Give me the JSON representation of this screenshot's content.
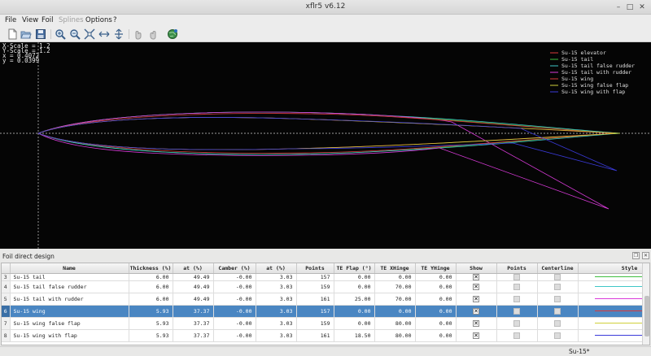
{
  "window": {
    "title": "xflr5 v6.12",
    "min_glyph": "–",
    "max_glyph": "□",
    "close_glyph": "✕"
  },
  "menu": {
    "items": [
      {
        "label": "File",
        "enabled": true
      },
      {
        "label": "View",
        "enabled": true
      },
      {
        "label": "Foil",
        "enabled": true
      },
      {
        "label": "Splines",
        "enabled": false
      },
      {
        "label": "Options",
        "enabled": true
      },
      {
        "label": "?",
        "enabled": true
      }
    ]
  },
  "toolbar": {
    "icons": [
      "new-file-icon",
      "open-file-icon",
      "save-icon",
      "zoom-in-icon",
      "zoom-out-icon",
      "reset-view-icon",
      "reset-x-scale-icon",
      "reset-y-scale-icon",
      "undo-icon",
      "redo-icon",
      "export-globe-icon"
    ]
  },
  "readout": {
    "x_scale": "X-Scale =  1.2",
    "y_scale": "Y-Scale =  1.2",
    "x": "x =  0.4072",
    "y": "y =  0.0399"
  },
  "legend": [
    {
      "name": "Su-15 elevator",
      "color": "#d93a3a"
    },
    {
      "name": "Su-15 tail",
      "color": "#3fbf3f"
    },
    {
      "name": "Su-15 tail false rudder",
      "color": "#3fc7c7"
    },
    {
      "name": "Su-15 tail with rudder",
      "color": "#d93ad9"
    },
    {
      "name": "Su-15 wing",
      "color": "#d93a3a"
    },
    {
      "name": "Su-15 wing false flap",
      "color": "#cfcf3a"
    },
    {
      "name": "Su-15 wing with flap",
      "color": "#3a3ad9"
    }
  ],
  "dock": {
    "title": "Foil direct design"
  },
  "table": {
    "headers": [
      "",
      "Name",
      "Thickness (%)",
      "at (%)",
      "Camber (%)",
      "at (%)",
      "Points",
      "TE Flap (°)",
      "TE XHinge",
      "TE YHinge",
      "Show",
      "Points",
      "Centerline",
      "Style"
    ],
    "rows": [
      {
        "index": "3",
        "name": "Su-15 tail",
        "thickness": "6.00",
        "thickness_at": "49.49",
        "camber": "-0.00",
        "camber_at": "3.03",
        "points": "157",
        "te_flap": "0.00",
        "te_xhinge": "0.00",
        "te_yhinge": "0.00",
        "show": "✕",
        "style_color": "#3fbf3f",
        "partial": true,
        "selected": false
      },
      {
        "index": "4",
        "name": "Su-15 tail false rudder",
        "thickness": "6.00",
        "thickness_at": "49.49",
        "camber": "-0.00",
        "camber_at": "3.03",
        "points": "159",
        "te_flap": "0.00",
        "te_xhinge": "70.00",
        "te_yhinge": "0.00",
        "show": "✕",
        "style_color": "#3fc7c7",
        "partial": false,
        "selected": false
      },
      {
        "index": "5",
        "name": "Su-15 tail with rudder",
        "thickness": "6.00",
        "thickness_at": "49.49",
        "camber": "-0.00",
        "camber_at": "3.03",
        "points": "161",
        "te_flap": "25.00",
        "te_xhinge": "70.00",
        "te_yhinge": "0.00",
        "show": "✕",
        "style_color": "#d93ad9",
        "partial": false,
        "selected": false
      },
      {
        "index": "6",
        "name": "Su-15 wing",
        "thickness": "5.93",
        "thickness_at": "37.37",
        "camber": "-0.00",
        "camber_at": "3.03",
        "points": "157",
        "te_flap": "0.00",
        "te_xhinge": "0.00",
        "te_yhinge": "0.00",
        "show": "✕",
        "style_color": "#d93a3a",
        "partial": false,
        "selected": true
      },
      {
        "index": "7",
        "name": "Su-15 wing false flap",
        "thickness": "5.93",
        "thickness_at": "37.37",
        "camber": "-0.00",
        "camber_at": "3.03",
        "points": "159",
        "te_flap": "0.00",
        "te_xhinge": "80.00",
        "te_yhinge": "0.00",
        "show": "✕",
        "style_color": "#cfcf3a",
        "partial": false,
        "selected": false
      },
      {
        "index": "8",
        "name": "Su-15 wing with flap",
        "thickness": "5.93",
        "thickness_at": "37.37",
        "camber": "-0.00",
        "camber_at": "3.03",
        "points": "161",
        "te_flap": "18.50",
        "te_xhinge": "80.00",
        "te_yhinge": "0.00",
        "show": "✕",
        "style_color": "#3a3ad9",
        "partial": false,
        "selected": false
      }
    ]
  },
  "status": {
    "current_foil": "Su-15*"
  }
}
